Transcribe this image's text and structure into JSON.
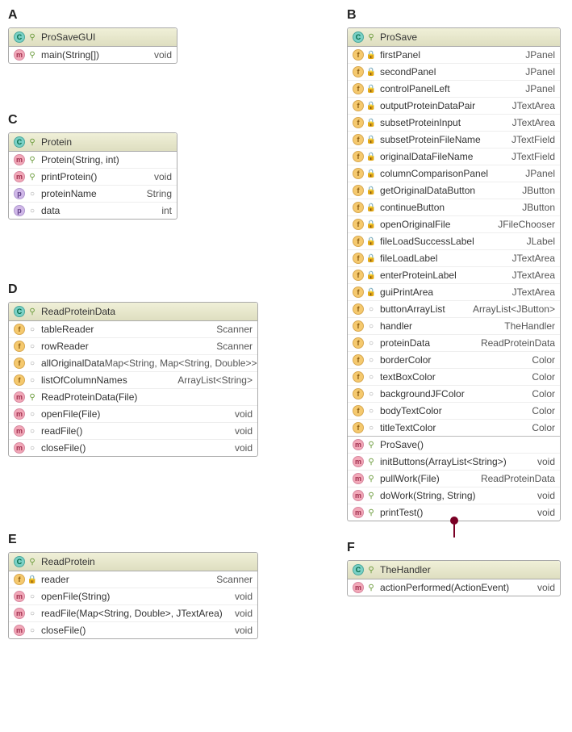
{
  "sections": {
    "A": {
      "label": "A",
      "className": "ProSaveGUI",
      "members": [
        {
          "kind": "method",
          "vis": "public",
          "name": "main(String[])",
          "type": "void"
        }
      ]
    },
    "B": {
      "label": "B",
      "className": "ProSave",
      "fields": [
        {
          "kind": "field",
          "vis": "private",
          "name": "firstPanel",
          "type": "JPanel"
        },
        {
          "kind": "field",
          "vis": "private",
          "name": "secondPanel",
          "type": "JPanel"
        },
        {
          "kind": "field",
          "vis": "private",
          "name": "controlPanelLeft",
          "type": "JPanel"
        },
        {
          "kind": "field",
          "vis": "private",
          "name": "outputProteinDataPair",
          "type": "JTextArea"
        },
        {
          "kind": "field",
          "vis": "private",
          "name": "subsetProteinInput",
          "type": "JTextArea"
        },
        {
          "kind": "field",
          "vis": "private",
          "name": "subsetProteinFileName",
          "type": "JTextField"
        },
        {
          "kind": "field",
          "vis": "private",
          "name": "originalDataFileName",
          "type": "JTextField"
        },
        {
          "kind": "field",
          "vis": "private",
          "name": "columnComparisonPanel",
          "type": "JPanel"
        },
        {
          "kind": "field",
          "vis": "private",
          "name": "getOriginalDataButton",
          "type": "JButton"
        },
        {
          "kind": "field",
          "vis": "private",
          "name": "continueButton",
          "type": "JButton"
        },
        {
          "kind": "field",
          "vis": "private",
          "name": "openOriginalFile",
          "type": "JFileChooser"
        },
        {
          "kind": "field",
          "vis": "private",
          "name": "fileLoadSuccessLabel",
          "type": "JLabel"
        },
        {
          "kind": "field",
          "vis": "private",
          "name": "fileLoadLabel",
          "type": "JTextArea"
        },
        {
          "kind": "field",
          "vis": "private",
          "name": "enterProteinLabel",
          "type": "JTextArea"
        },
        {
          "kind": "field",
          "vis": "private",
          "name": "guiPrintArea",
          "type": "JTextArea"
        },
        {
          "kind": "field",
          "vis": "pkg",
          "name": "buttonArrayList",
          "type": "ArrayList<JButton>"
        },
        {
          "kind": "field",
          "vis": "pkg",
          "name": "handler",
          "type": "TheHandler"
        },
        {
          "kind": "field",
          "vis": "pkg",
          "name": "proteinData",
          "type": "ReadProteinData"
        },
        {
          "kind": "field",
          "vis": "pkg",
          "name": "borderColor",
          "type": "Color"
        },
        {
          "kind": "field",
          "vis": "pkg",
          "name": "textBoxColor",
          "type": "Color"
        },
        {
          "kind": "field",
          "vis": "pkg",
          "name": "backgroundJFColor",
          "type": "Color"
        },
        {
          "kind": "field",
          "vis": "pkg",
          "name": "bodyTextColor",
          "type": "Color"
        },
        {
          "kind": "field",
          "vis": "pkg",
          "name": "titleTextColor",
          "type": "Color"
        }
      ],
      "methods": [
        {
          "kind": "method",
          "vis": "public",
          "name": "ProSave()",
          "type": ""
        },
        {
          "kind": "method",
          "vis": "public",
          "name": "initButtons(ArrayList<String>)",
          "type": "void"
        },
        {
          "kind": "method",
          "vis": "public",
          "name": "pullWork(File)",
          "type": "ReadProteinData"
        },
        {
          "kind": "method",
          "vis": "public",
          "name": "doWork(String, String)",
          "type": "void"
        },
        {
          "kind": "method",
          "vis": "public",
          "name": "printTest()",
          "type": "void"
        }
      ]
    },
    "C": {
      "label": "C",
      "className": "Protein",
      "members": [
        {
          "kind": "method",
          "vis": "public",
          "name": "Protein(String, int)",
          "type": ""
        },
        {
          "kind": "method",
          "vis": "public",
          "name": "printProtein()",
          "type": "void"
        },
        {
          "kind": "prop",
          "vis": "pkg",
          "name": "proteinName",
          "type": "String"
        },
        {
          "kind": "prop",
          "vis": "pkg",
          "name": "data",
          "type": "int"
        }
      ]
    },
    "D": {
      "label": "D",
      "className": "ReadProteinData",
      "members": [
        {
          "kind": "field",
          "vis": "pkg",
          "name": "tableReader",
          "type": "Scanner"
        },
        {
          "kind": "field",
          "vis": "pkg",
          "name": "rowReader",
          "type": "Scanner"
        },
        {
          "kind": "field",
          "vis": "pkg",
          "name": "allOriginalData",
          "type": "Map<String, Map<String, Double>>"
        },
        {
          "kind": "field",
          "vis": "pkg",
          "name": "listOfColumnNames",
          "type": "ArrayList<String>"
        },
        {
          "kind": "method",
          "vis": "public",
          "name": "ReadProteinData(File)",
          "type": ""
        },
        {
          "kind": "method",
          "vis": "pkg",
          "name": "openFile(File)",
          "type": "void"
        },
        {
          "kind": "method",
          "vis": "pkg",
          "name": "readFile()",
          "type": "void"
        },
        {
          "kind": "method",
          "vis": "pkg",
          "name": "closeFile()",
          "type": "void"
        }
      ]
    },
    "E": {
      "label": "E",
      "className": "ReadProtein",
      "members": [
        {
          "kind": "field",
          "vis": "private",
          "name": "reader",
          "type": "Scanner"
        },
        {
          "kind": "method",
          "vis": "pkg",
          "name": "openFile(String)",
          "type": "void"
        },
        {
          "kind": "method",
          "vis": "pkg",
          "name": "readFile(Map<String, Double>, JTextArea)",
          "type": "void"
        },
        {
          "kind": "method",
          "vis": "pkg",
          "name": "closeFile()",
          "type": "void"
        }
      ]
    },
    "F": {
      "label": "F",
      "className": "TheHandler",
      "members": [
        {
          "kind": "method",
          "vis": "public",
          "name": "actionPerformed(ActionEvent)",
          "type": "void"
        }
      ]
    }
  },
  "iconGlyphs": {
    "class": "C",
    "method": "m",
    "field": "f",
    "prop": "p"
  },
  "visGlyphs": {
    "public": "⚲",
    "private": "🔒",
    "pkg": "○"
  }
}
